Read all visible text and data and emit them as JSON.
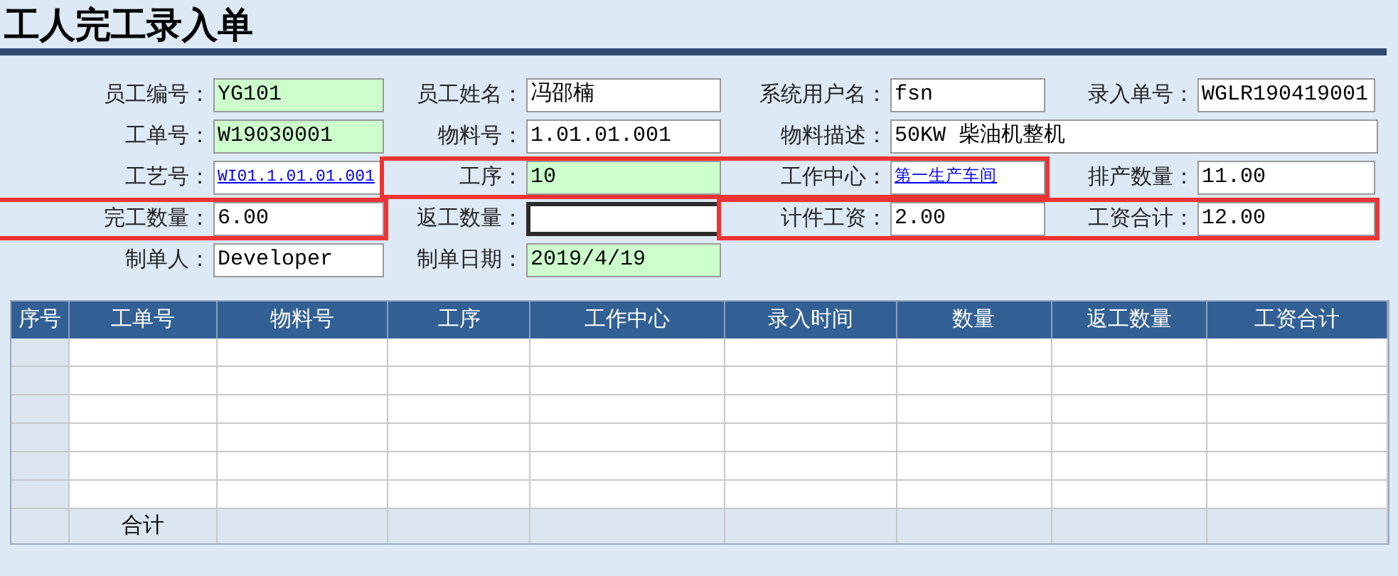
{
  "title": "工人完工录入单",
  "form": {
    "rows": [
      {
        "groups": [
          {
            "highlighted": false,
            "fields": [
              {
                "label": "员工编号：",
                "value": "YG101",
                "kind": "shaded"
              },
              {
                "label": "员工姓名：",
                "value": "冯邵楠",
                "kind": "plain"
              },
              {
                "label": "系统用户名：",
                "value": "fsn",
                "kind": "plain"
              },
              {
                "label": "录入单号：",
                "value": "WGLR190419001",
                "kind": "plain"
              }
            ]
          }
        ]
      },
      {
        "groups": [
          {
            "highlighted": false,
            "fields": [
              {
                "label": "工单号：",
                "value": "W19030001",
                "kind": "shaded"
              },
              {
                "label": "物料号：",
                "value": "1.01.01.001",
                "kind": "plain"
              },
              {
                "label": "物料描述：",
                "value": "50KW 柴油机整机",
                "kind": "wide"
              }
            ]
          }
        ]
      },
      {
        "groups": [
          {
            "highlighted": false,
            "fields": [
              {
                "label": "工艺号：",
                "value": "WI01.1.01.01.001",
                "kind": "link"
              }
            ]
          },
          {
            "highlighted": true,
            "fields": [
              {
                "label": "工序：",
                "value": "10",
                "kind": "shaded"
              },
              {
                "label": "工作中心：",
                "value": "第一生产车间",
                "kind": "link"
              }
            ]
          },
          {
            "highlighted": false,
            "fields": [
              {
                "label": "排产数量：",
                "value": "11.00",
                "kind": "plain"
              }
            ]
          }
        ]
      },
      {
        "groups": [
          {
            "highlighted": true,
            "fields": [
              {
                "label": "完工数量：",
                "value": "6.00",
                "kind": "plain"
              }
            ]
          },
          {
            "highlighted": false,
            "fields": [
              {
                "label": "返工数量：",
                "kind": "focused"
              }
            ]
          },
          {
            "highlighted": true,
            "fields": [
              {
                "label": "计件工资：",
                "value": "2.00",
                "kind": "plain"
              },
              {
                "label": "工资合计：",
                "value": "12.00",
                "kind": "plain"
              }
            ]
          }
        ]
      },
      {
        "groups": [
          {
            "highlighted": false,
            "fields": [
              {
                "label": "制单人：",
                "value": "Developer",
                "kind": "plain"
              },
              {
                "label": "制单日期：",
                "value": "2019/4/19",
                "kind": "shaded"
              }
            ]
          }
        ]
      }
    ]
  },
  "table": {
    "columns": [
      "序号",
      "工单号",
      "物料号",
      "工序",
      "工作中心",
      "录入时间",
      "数量",
      "返工数量",
      "工资合计"
    ],
    "footer": {
      "label": "合计"
    }
  }
}
